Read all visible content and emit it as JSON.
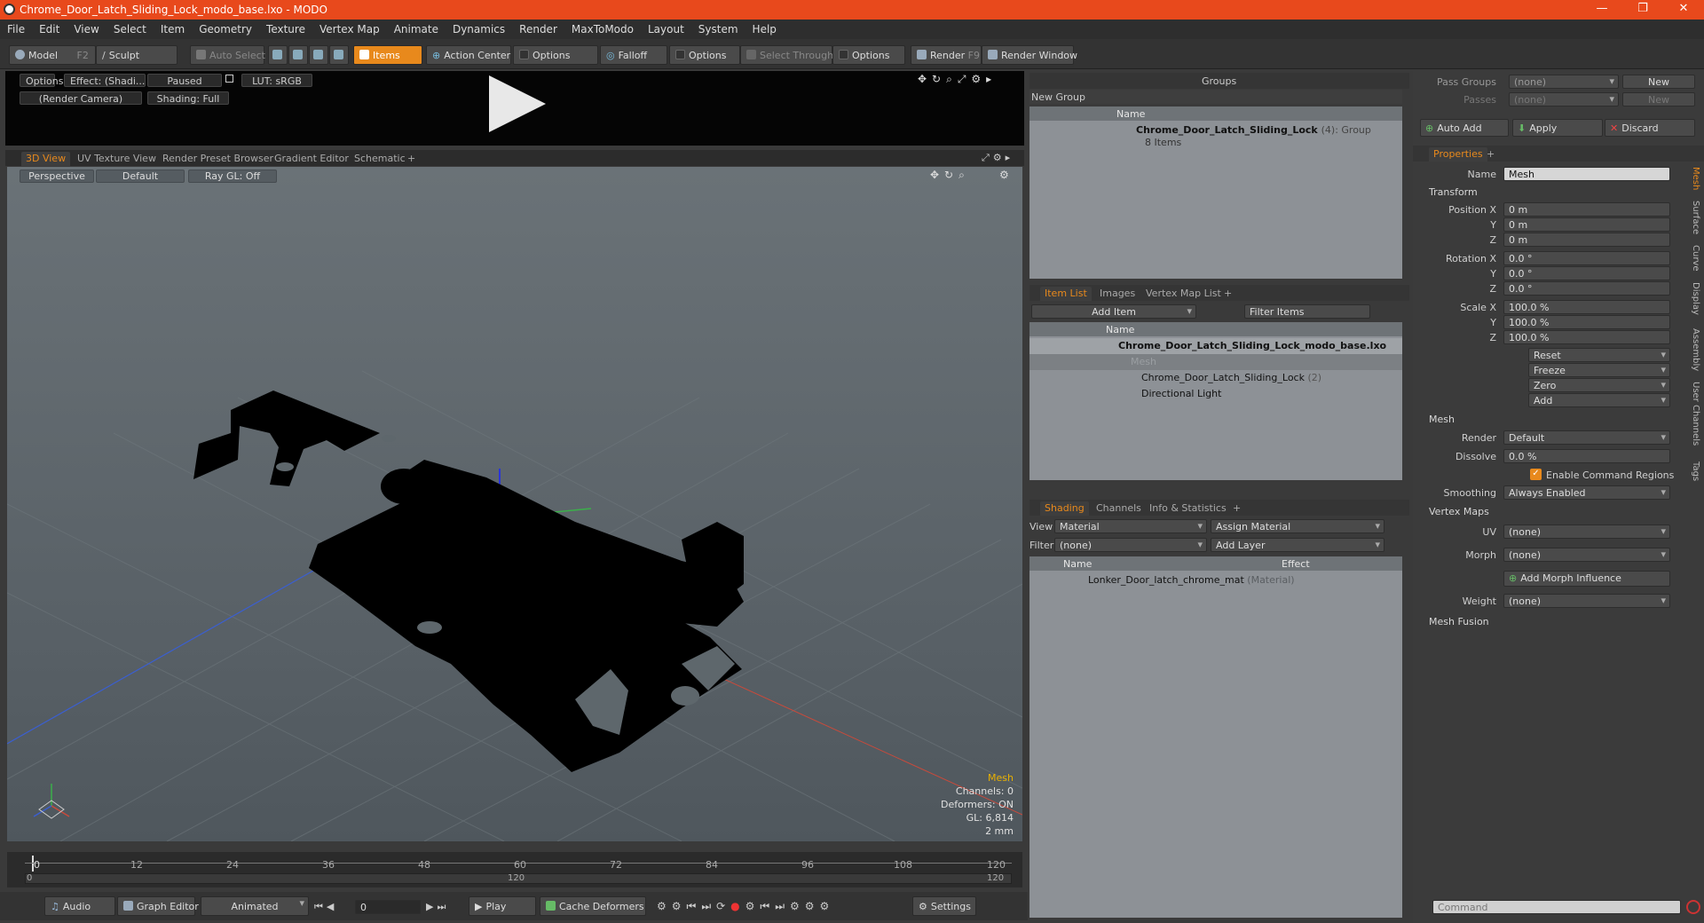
{
  "window": {
    "title": "Chrome_Door_Latch_Sliding_Lock_modo_base.lxo - MODO",
    "controls": [
      "—",
      "❐",
      "✕"
    ]
  },
  "menu": [
    "File",
    "Edit",
    "View",
    "Select",
    "Item",
    "Geometry",
    "Texture",
    "Vertex Map",
    "Animate",
    "Dynamics",
    "Render",
    "MaxToModo",
    "Layout",
    "System",
    "Help"
  ],
  "toolbar": {
    "model": "Model",
    "model_key": "F2",
    "sculpt": "Sculpt",
    "auto_select": "Auto Select",
    "items": "Items",
    "action_center": "Action Center",
    "options1": "Options",
    "falloff": "Falloff",
    "options2": "Options",
    "select_through": "Select Through",
    "options3": "Options",
    "render": "Render",
    "render_key": "F9",
    "render_window": "Render Window"
  },
  "preview": {
    "options": "Options",
    "effect": "Effect: (Shadi...",
    "paused": "Paused",
    "lut": "LUT: sRGB",
    "camera": "(Render Camera)",
    "shading": "Shading: Full"
  },
  "viewport_tabs": [
    "3D View",
    "UV Texture View",
    "Render Preset Browser",
    "Gradient Editor",
    "Schematic",
    "+"
  ],
  "viewport": {
    "perspective": "Perspective",
    "default": "Default",
    "raygl": "Ray GL: Off",
    "hud": {
      "item": "Mesh",
      "channels": "Channels: 0",
      "deformers": "Deformers: ON",
      "gl": "GL: 6,814",
      "scale": "2 mm"
    }
  },
  "timeline": {
    "ticks": [
      "0",
      "12",
      "24",
      "36",
      "48",
      "60",
      "72",
      "84",
      "96",
      "108",
      "120"
    ],
    "sub_start": "0",
    "sub_mid": "120",
    "sub_end": "120"
  },
  "bottombar": {
    "audio": "Audio",
    "graph_editor": "Graph Editor",
    "animated": "Animated",
    "frame": "0",
    "play": "Play",
    "cache_deformers": "Cache Deformers",
    "settings": "Settings"
  },
  "groups": {
    "title": "Groups",
    "new_group": "New Group",
    "col_name": "Name",
    "item_name": "Chrome_Door_Latch_Sliding_Lock",
    "item_count": "(4)",
    "item_type": ": Group",
    "item_sub": "8 Items"
  },
  "itemlist": {
    "tabs": [
      "Item List",
      "Images",
      "Vertex Map List",
      "+"
    ],
    "add_item": "Add Item",
    "filter": "Filter Items",
    "col_name": "Name",
    "rows": [
      {
        "name": "Chrome_Door_Latch_Sliding_Lock_modo_base.lxo",
        "extra": ""
      },
      {
        "name": "Mesh",
        "extra": ""
      },
      {
        "name": "Chrome_Door_Latch_Sliding_Lock",
        "extra": "(2)"
      },
      {
        "name": "Directional Light",
        "extra": ""
      }
    ]
  },
  "shading": {
    "tabs": [
      "Shading",
      "Channels",
      "Info & Statistics",
      "+"
    ],
    "view_label": "View",
    "view_value": "Material",
    "assign_material": "Assign Material",
    "filter_label": "Filter",
    "filter_value": "(none)",
    "add_layer": "Add Layer",
    "col_name": "Name",
    "col_effect": "Effect",
    "row_name": "Lonker_Door_latch_chrome_mat",
    "row_type": "(Material)"
  },
  "passes": {
    "pass_groups_label": "Pass Groups",
    "pass_groups_value": "(none)",
    "passes_label": "Passes",
    "passes_value": "(none)",
    "new1": "New",
    "new2": "New",
    "auto_add": "Auto Add",
    "apply": "Apply",
    "discard": "Discard"
  },
  "properties": {
    "tab": "Properties",
    "name_label": "Name",
    "name_value": "Mesh",
    "transform": "Transform",
    "position_label": "Position X",
    "rotation_label": "Rotation X",
    "scale_label": "Scale X",
    "y": "Y",
    "z": "Z",
    "pos": [
      "0 m",
      "0 m",
      "0 m"
    ],
    "rot": [
      "0.0 °",
      "0.0 °",
      "0.0 °"
    ],
    "scl": [
      "100.0 %",
      "100.0 %",
      "100.0 %"
    ],
    "reset": "Reset",
    "freeze": "Freeze",
    "zero": "Zero",
    "add": "Add",
    "mesh_section": "Mesh",
    "render_label": "Render",
    "render_value": "Default",
    "dissolve_label": "Dissolve",
    "dissolve_value": "0.0 %",
    "enable_cmd": "Enable Command Regions",
    "smoothing_label": "Smoothing",
    "smoothing_value": "Always Enabled",
    "vertex_maps": "Vertex Maps",
    "uv_label": "UV",
    "uv_value": "(none)",
    "morph_label": "Morph",
    "morph_value": "(none)",
    "add_morph": "Add Morph Influence",
    "weight_label": "Weight",
    "weight_value": "(none)",
    "mesh_fusion": "Mesh Fusion",
    "vtabs": [
      "Mesh",
      "Surface",
      "Curve",
      "Display",
      "Assembly",
      "User Channels",
      "Tags"
    ]
  },
  "command": {
    "placeholder": "Command"
  },
  "colors": {
    "accent": "#e8891c",
    "titlebar": "#e8491c"
  }
}
